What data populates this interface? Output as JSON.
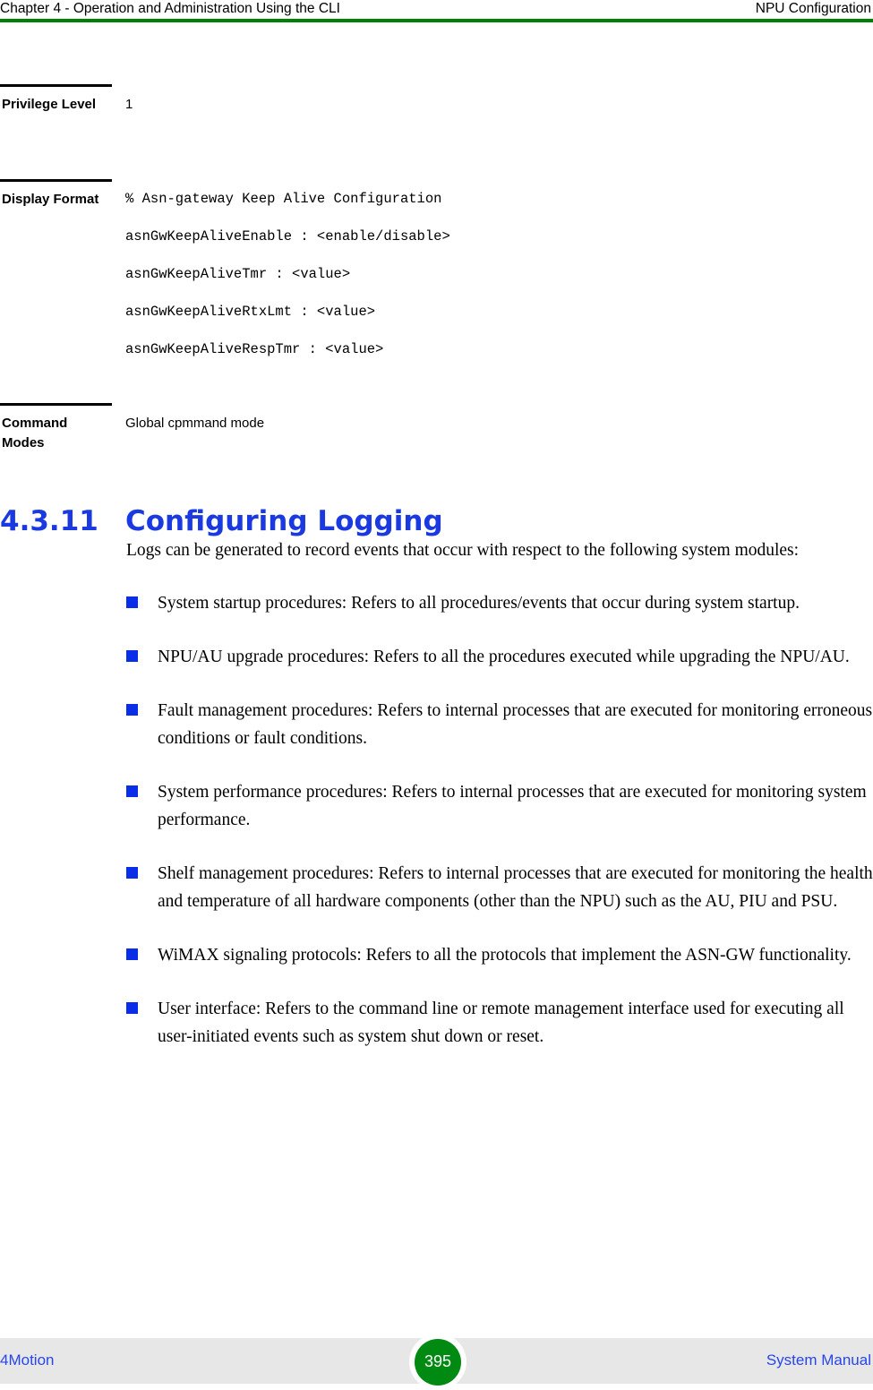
{
  "header": {
    "left": "Chapter 4 - Operation and Administration Using the CLI",
    "right": "NPU Configuration",
    "rule_color": "#008000"
  },
  "command_table": {
    "rows": [
      {
        "label": "Privilege Level",
        "value": "1"
      },
      {
        "label": "Display Format",
        "lines": [
          "% Asn-gateway Keep Alive Configuration",
          "asnGwKeepAliveEnable : <enable/disable>",
          "asnGwKeepAliveTmr : <value>",
          "asnGwKeepAliveRtxLmt : <value>",
          "asnGwKeepAliveRespTmr : <value>"
        ]
      },
      {
        "label": "Command Modes",
        "value": "Global cpmmand mode"
      }
    ]
  },
  "section": {
    "number": "4.3.11",
    "title": "Configuring Logging",
    "heading_color": "#1a39e0",
    "intro": "Logs can be generated to record events that occur with respect to the following system modules:",
    "bullet_color": "#0a2ee8",
    "bullets": [
      "System startup procedures: Refers to all procedures/events that occur during system startup.",
      "NPU/AU upgrade procedures: Refers to all the procedures executed while upgrading the NPU/AU.",
      "Fault management procedures: Refers to internal processes that are executed for monitoring erroneous conditions or fault conditions.",
      "System performance procedures: Refers to internal processes that are executed for monitoring system performance.",
      "Shelf management procedures: Refers to internal processes that are executed for monitoring the health and temperature of all hardware components (other than the NPU) such as the AU, PIU and PSU.",
      "WiMAX signaling protocols: Refers to all the protocols that implement the ASN-GW functionality.",
      "User interface: Refers to the command line or remote management interface used for executing all user-initiated events such as system shut down or reset."
    ]
  },
  "footer": {
    "left": "4Motion",
    "page_number": "395",
    "right": "System Manual",
    "band_color": "#e7e7e7",
    "badge_color": "#008a12",
    "link_color": "#2846e8"
  }
}
